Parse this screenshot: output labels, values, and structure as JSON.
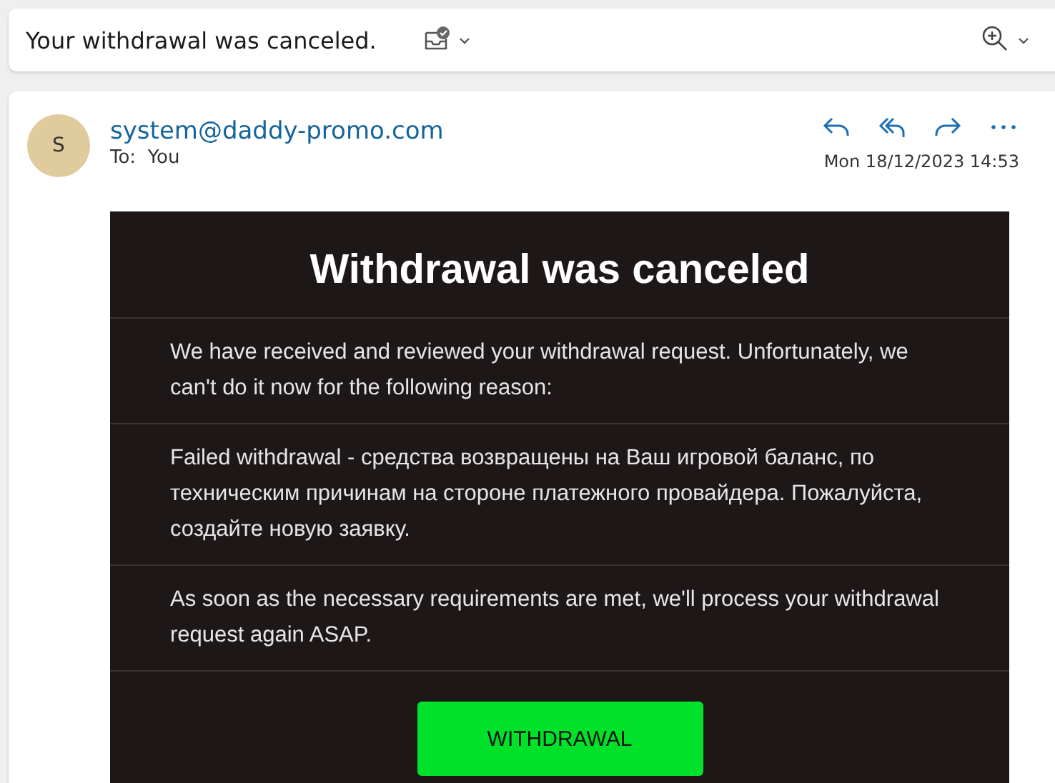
{
  "subject": "Your withdrawal was canceled.",
  "sender": {
    "initial": "S",
    "address": "system@daddy-promo.com",
    "to_label": "To:",
    "to": "You",
    "date": "Mon 18/12/2023 14:53"
  },
  "message": {
    "title": "Withdrawal was canceled",
    "paragraphs": [
      "We have received and reviewed your withdrawal request. Unfortunately, we can't do it now for the following reason:",
      "Failed withdrawal - средства возвращены на Ваш игровой баланс, по техническим причинам на стороне платежного провайдера. Пожалуйста, создайте новую заявку.",
      "As soon as the necessary requirements are met, we'll process your withdrawal request again ASAP."
    ],
    "button": "WITHDRAWAL"
  }
}
